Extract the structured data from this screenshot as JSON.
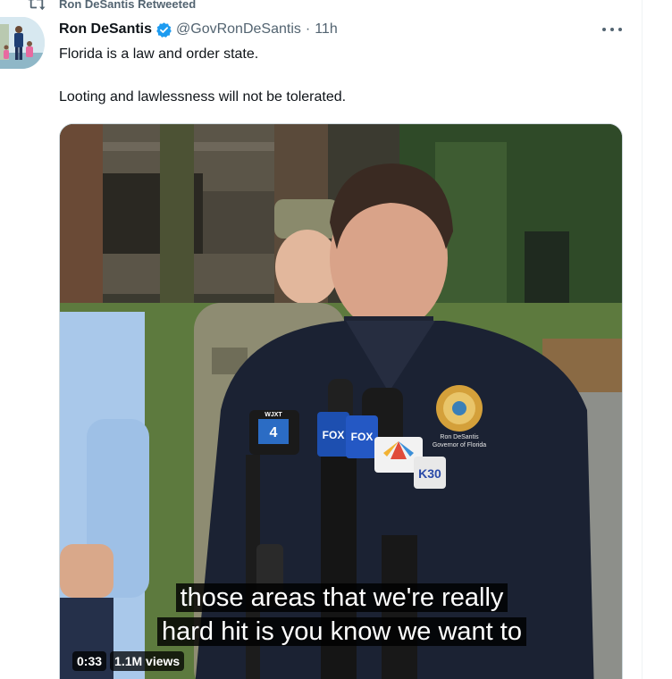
{
  "retweet": {
    "label": "Ron DeSantis Retweeted"
  },
  "author": {
    "name": "Ron DeSantis",
    "handle": "@GovRonDeSantis",
    "separator": "·",
    "time": "11h",
    "verified": true,
    "verified_color": "#1d9bf0"
  },
  "tweet": {
    "line1": "Florida is a law and order state.",
    "line2": "Looting and lawlessness will not be tolerated."
  },
  "video": {
    "caption_line1": "those areas that we're really",
    "caption_line2": "hard hit is you know we want to",
    "duration": "0:33",
    "views": "1.1M views",
    "mic_labels": {
      "wjxt": "WJXT",
      "fox1": "FOX",
      "fox2": "FOX",
      "k30": "K30",
      "seal_text": "Ron DeSantis Governor of Florida"
    }
  },
  "icons": {
    "retweet": "retweet-icon",
    "verified": "verified-badge-icon",
    "more": "more-options-icon"
  }
}
